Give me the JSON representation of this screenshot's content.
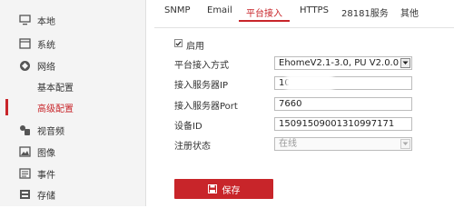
{
  "sidebar": {
    "items": [
      {
        "label": "本地",
        "icon": "monitor-icon"
      },
      {
        "label": "系统",
        "icon": "system-icon"
      },
      {
        "label": "网络",
        "icon": "network-icon"
      },
      {
        "label": "基本配置"
      },
      {
        "label": "高级配置"
      },
      {
        "label": "视音频",
        "icon": "video-audio-icon"
      },
      {
        "label": "图像",
        "icon": "image-icon"
      },
      {
        "label": "事件",
        "icon": "event-icon"
      },
      {
        "label": "存储",
        "icon": "storage-icon"
      }
    ],
    "active_item": "高级配置"
  },
  "tabs": [
    {
      "label": "SNMP"
    },
    {
      "label": "Email"
    },
    {
      "label": "平台接入",
      "active": true
    },
    {
      "label": "HTTPS"
    },
    {
      "label": "28181服务"
    },
    {
      "label": "其他"
    }
  ],
  "form": {
    "enable_label": "启用",
    "enable_checked": true,
    "access_mode_label": "平台接入方式",
    "access_mode_value": "EhomeV2.1-3.0, PU V2.0.0",
    "server_ip_label": "接入服务器IP",
    "server_ip_value": "10.",
    "server_port_label": "接入服务器Port",
    "server_port_value": "7660",
    "device_id_label": "设备ID",
    "device_id_value": "15091509001310997171",
    "register_status_label": "注册状态",
    "register_status_value": "在线"
  },
  "save_button": {
    "label": "保存",
    "icon": "save-icon"
  },
  "colors": {
    "accent": "#c8252a",
    "sidebar_bg": "#f4f4f4"
  }
}
